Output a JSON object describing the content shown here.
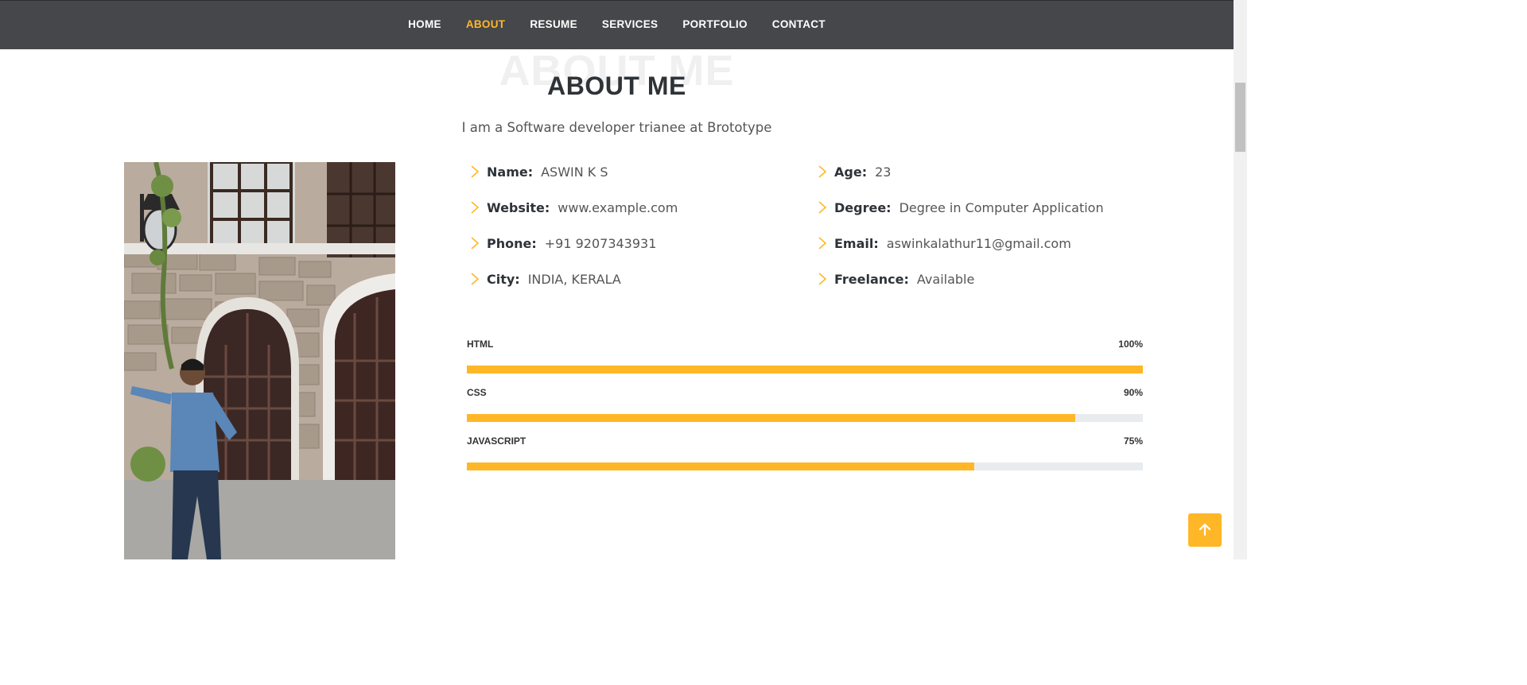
{
  "nav": {
    "items": [
      {
        "label": "HOME",
        "active": false
      },
      {
        "label": "ABOUT",
        "active": true
      },
      {
        "label": "RESUME",
        "active": false
      },
      {
        "label": "SERVICES",
        "active": false
      },
      {
        "label": "PORTFOLIO",
        "active": false
      },
      {
        "label": "CONTACT",
        "active": false
      }
    ]
  },
  "about": {
    "bg_title": "ABOUT ME",
    "title": "ABOUT ME",
    "subtitle": "I am a Software developer trianee at Brototype",
    "info": [
      {
        "label": "Name:",
        "value": "ASWIN K S"
      },
      {
        "label": "Age:",
        "value": "23"
      },
      {
        "label": "Website:",
        "value": "www.example.com"
      },
      {
        "label": "Degree:",
        "value": "Degree in Computer Application"
      },
      {
        "label": "Phone:",
        "value": "+91 9207343931"
      },
      {
        "label": "Email:",
        "value": "aswinkalathur11@gmail.com"
      },
      {
        "label": "City:",
        "value": "INDIA, KERALA"
      },
      {
        "label": "Freelance:",
        "value": "Available"
      }
    ]
  },
  "skills": [
    {
      "name": "HTML",
      "label": "100%",
      "percent": 100
    },
    {
      "name": "CSS",
      "label": "90%",
      "percent": 90
    },
    {
      "name": "JAVASCRIPT",
      "label": "75%",
      "percent": 75
    }
  ],
  "colors": {
    "accent": "#ffb727",
    "navbar": "#46474b",
    "heading": "#2e3338"
  },
  "icons": {
    "info_bullet": "chevron-right-icon",
    "back_to_top": "arrow-up-icon"
  }
}
